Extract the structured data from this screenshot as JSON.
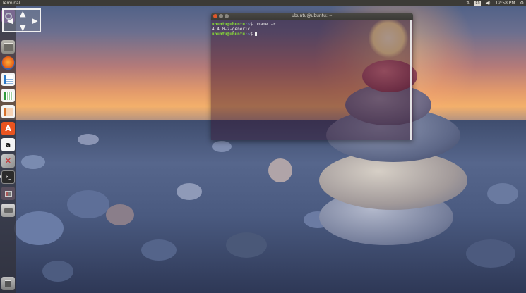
{
  "panel": {
    "app_title": "Terminal",
    "clock": "12:58 PM",
    "tray_icons": [
      "network-arrows-icon",
      "keyboard-layout-icon",
      "volume-icon",
      "clock",
      "settings-gear-icon"
    ],
    "keyboard_label": "En"
  },
  "launcher": {
    "items": [
      {
        "name": "dash-home",
        "icon": "ubuntu-logo-icon"
      },
      {
        "name": "files",
        "icon": "file-cabinet-icon"
      },
      {
        "name": "firefox",
        "icon": "firefox-icon"
      },
      {
        "name": "libreoffice-writer",
        "icon": "writer-doc-icon"
      },
      {
        "name": "libreoffice-calc",
        "icon": "calc-sheet-icon"
      },
      {
        "name": "libreoffice-impress",
        "icon": "impress-slides-icon"
      },
      {
        "name": "ubuntu-software",
        "icon": "software-bag-icon",
        "glyph": "A"
      },
      {
        "name": "amazon",
        "icon": "amazon-icon",
        "glyph": "a"
      },
      {
        "name": "system-settings",
        "icon": "tools-icon"
      },
      {
        "name": "terminal",
        "icon": "terminal-icon",
        "glyph": ">_"
      },
      {
        "name": "workspace-switcher",
        "icon": "workspaces-icon"
      },
      {
        "name": "removable-drive",
        "icon": "drive-icon"
      },
      {
        "name": "trash",
        "icon": "trash-icon"
      }
    ]
  },
  "terminal": {
    "title": "ubuntu@ubuntu: ~",
    "lines": [
      {
        "user": "ubuntu@ubuntu",
        "path": ":~",
        "prompt": "$ ",
        "command": "uname -r"
      },
      {
        "output": "4.4.0-2-generic"
      },
      {
        "user": "ubuntu@ubuntu",
        "path": ":~",
        "prompt": "$ ",
        "command": ""
      }
    ]
  },
  "colors": {
    "panel_bg": "#3c3b37",
    "prompt_user": "#8ae234",
    "prompt_path": "#729fcf",
    "close_button": "#e0562a"
  }
}
